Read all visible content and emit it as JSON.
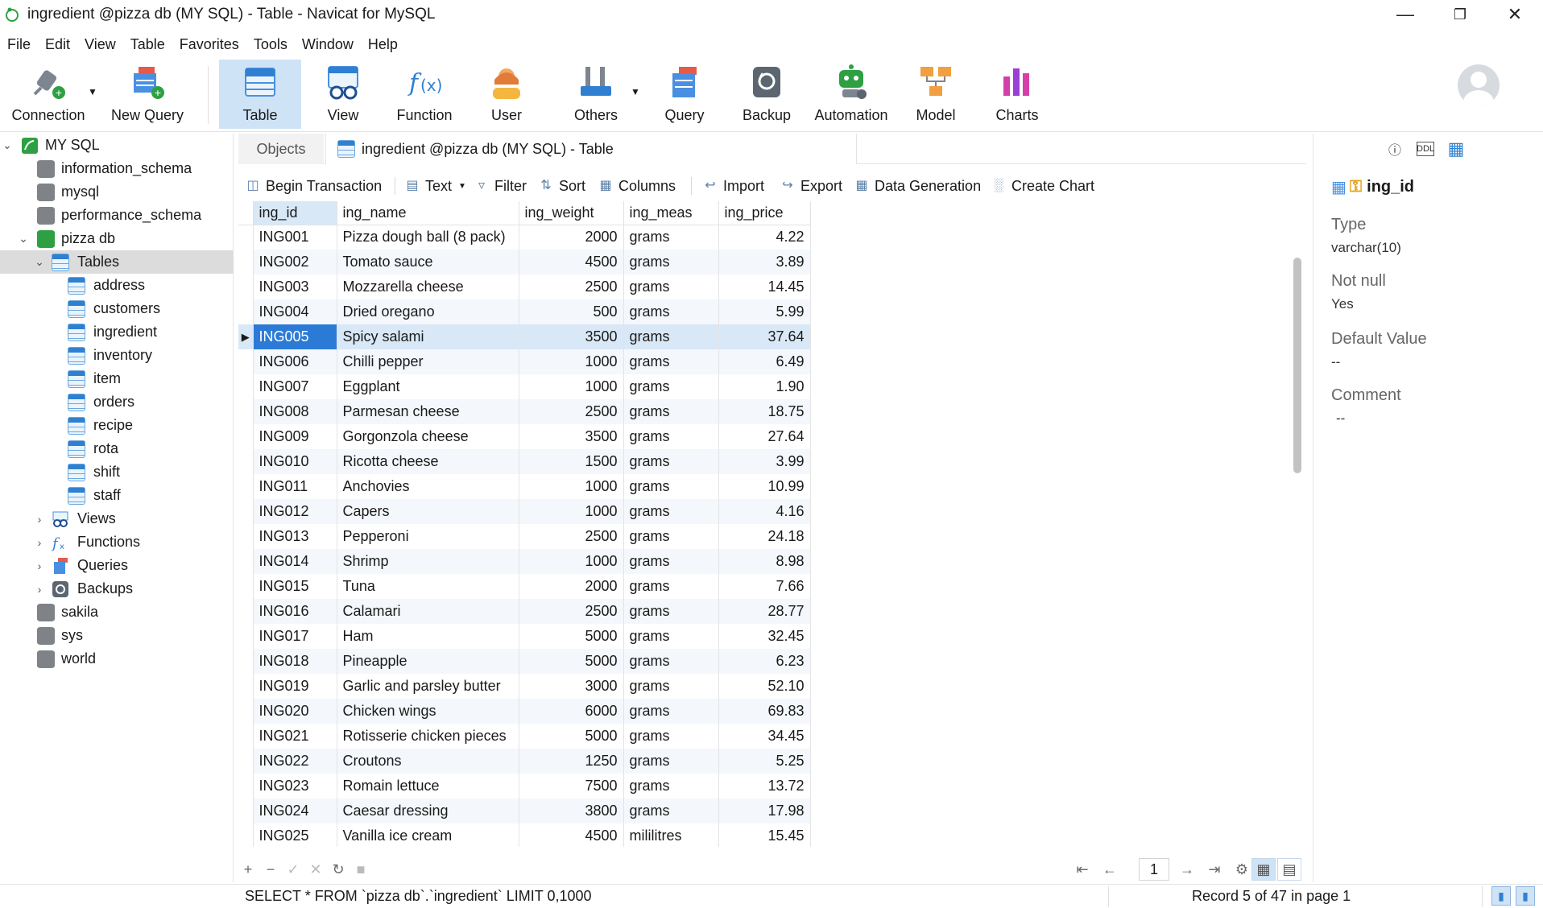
{
  "window": {
    "title": "ingredient @pizza db (MY SQL) - Table - Navicat for MySQL",
    "minimize_icon": "minimize-icon",
    "restore_icon": "restore-icon",
    "close_icon": "close-icon"
  },
  "menu": [
    "File",
    "Edit",
    "View",
    "Table",
    "Favorites",
    "Tools",
    "Window",
    "Help"
  ],
  "ribbon": [
    {
      "label": "Connection",
      "icon": "connection-plug-icon"
    },
    {
      "label": "New Query",
      "icon": "new-query-icon"
    },
    {
      "label": "Table",
      "icon": "table-icon",
      "active": true
    },
    {
      "label": "View",
      "icon": "view-glasses-icon"
    },
    {
      "label": "Function",
      "icon": "function-fx-icon"
    },
    {
      "label": "User",
      "icon": "user-icon"
    },
    {
      "label": "Others",
      "icon": "tools-icon"
    },
    {
      "label": "Query",
      "icon": "query-icon"
    },
    {
      "label": "Backup",
      "icon": "backup-icon"
    },
    {
      "label": "Automation",
      "icon": "robot-icon"
    },
    {
      "label": "Model",
      "icon": "model-icon"
    },
    {
      "label": "Charts",
      "icon": "charts-icon"
    }
  ],
  "tree": {
    "connection": "MY SQL",
    "databases_top": [
      "information_schema",
      "mysql",
      "performance_schema"
    ],
    "open_db": "pizza db",
    "tables_label": "Tables",
    "tables": [
      "address",
      "customers",
      "ingredient",
      "inventory",
      "item",
      "orders",
      "recipe",
      "rota",
      "shift",
      "staff"
    ],
    "groups": [
      "Views",
      "Functions",
      "Queries",
      "Backups"
    ],
    "databases_bottom": [
      "sakila",
      "sys",
      "world"
    ]
  },
  "tabs": {
    "objects": "Objects",
    "active": "ingredient @pizza db (MY SQL) - Table"
  },
  "toolbar": {
    "begin_transaction": "Begin Transaction",
    "text": "Text",
    "filter": "Filter",
    "sort": "Sort",
    "columns": "Columns",
    "import": "Import",
    "export": "Export",
    "data_generation": "Data Generation",
    "create_chart": "Create Chart"
  },
  "grid": {
    "columns": [
      "ing_id",
      "ing_name",
      "ing_weight",
      "ing_meas",
      "ing_price"
    ],
    "selected_row": 4,
    "rows": [
      [
        "ING001",
        "Pizza dough ball (8 pack)",
        "2000",
        "grams",
        "4.22"
      ],
      [
        "ING002",
        "Tomato sauce",
        "4500",
        "grams",
        "3.89"
      ],
      [
        "ING003",
        "Mozzarella cheese",
        "2500",
        "grams",
        "14.45"
      ],
      [
        "ING004",
        "Dried oregano",
        "500",
        "grams",
        "5.99"
      ],
      [
        "ING005",
        "Spicy salami",
        "3500",
        "grams",
        "37.64"
      ],
      [
        "ING006",
        "Chilli pepper",
        "1000",
        "grams",
        "6.49"
      ],
      [
        "ING007",
        "Eggplant",
        "1000",
        "grams",
        "1.90"
      ],
      [
        "ING008",
        "Parmesan cheese",
        "2500",
        "grams",
        "18.75"
      ],
      [
        "ING009",
        "Gorgonzola cheese",
        "3500",
        "grams",
        "27.64"
      ],
      [
        "ING010",
        "Ricotta cheese",
        "1500",
        "grams",
        "3.99"
      ],
      [
        "ING011",
        "Anchovies",
        "1000",
        "grams",
        "10.99"
      ],
      [
        "ING012",
        "Capers",
        "1000",
        "grams",
        "4.16"
      ],
      [
        "ING013",
        "Pepperoni",
        "2500",
        "grams",
        "24.18"
      ],
      [
        "ING014",
        "Shrimp",
        "1000",
        "grams",
        "8.98"
      ],
      [
        "ING015",
        "Tuna",
        "2000",
        "grams",
        "7.66"
      ],
      [
        "ING016",
        "Calamari",
        "2500",
        "grams",
        "28.77"
      ],
      [
        "ING017",
        "Ham",
        "5000",
        "grams",
        "32.45"
      ],
      [
        "ING018",
        "Pineapple",
        "5000",
        "grams",
        "6.23"
      ],
      [
        "ING019",
        "Garlic and parsley butter",
        "3000",
        "grams",
        "52.10"
      ],
      [
        "ING020",
        "Chicken wings",
        "6000",
        "grams",
        "69.83"
      ],
      [
        "ING021",
        "Rotisserie chicken pieces",
        "5000",
        "grams",
        "34.45"
      ],
      [
        "ING022",
        "Croutons",
        "1250",
        "grams",
        "5.25"
      ],
      [
        "ING023",
        "Romain lettuce",
        "7500",
        "grams",
        "13.72"
      ],
      [
        "ING024",
        "Caesar dressing",
        "3800",
        "grams",
        "17.98"
      ],
      [
        "ING025",
        "Vanilla ice cream",
        "4500",
        "mililitres",
        "15.45"
      ]
    ]
  },
  "pager": {
    "page": "1"
  },
  "status": {
    "sql": "SELECT * FROM `pizza db`.`ingredient` LIMIT 0,1000",
    "record": "Record 5 of 47 in page 1"
  },
  "info": {
    "field": "ing_id",
    "type_label": "Type",
    "type_value": "varchar(10)",
    "notnull_label": "Not null",
    "notnull_value": "Yes",
    "default_label": "Default Value",
    "default_value": "--",
    "comment_label": "Comment",
    "comment_value": "--"
  }
}
